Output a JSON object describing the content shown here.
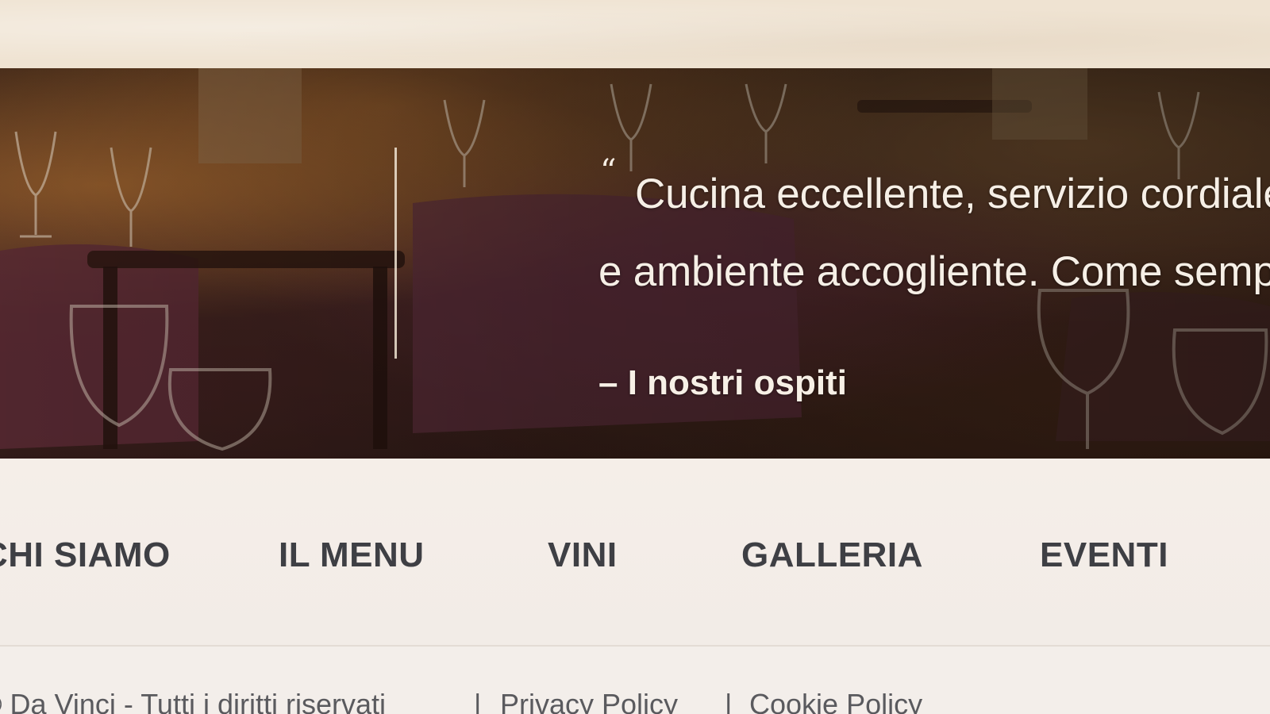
{
  "testimonial": {
    "quote_mark": "“",
    "line1": "Cucina eccellente, servizio cordiale",
    "line2": "e ambiente accogliente. Come sempre!",
    "author": "– I nostri ospiti"
  },
  "nav": {
    "items": [
      {
        "label": "CHI SIAMO"
      },
      {
        "label": "IL MENU"
      },
      {
        "label": "VINI"
      },
      {
        "label": "GALLERIA"
      },
      {
        "label": "EVENTI"
      }
    ]
  },
  "footer": {
    "copyright": "© Da Vinci - Tutti i diritti riservati",
    "separator": "|",
    "privacy": "Privacy Policy",
    "cookie": "Cookie Policy"
  },
  "colors": {
    "page_bg": "#f3eeea",
    "nav_text": "#3e3f44",
    "quote_text": "#f6efe6",
    "hero_dark": "#3a2418"
  }
}
